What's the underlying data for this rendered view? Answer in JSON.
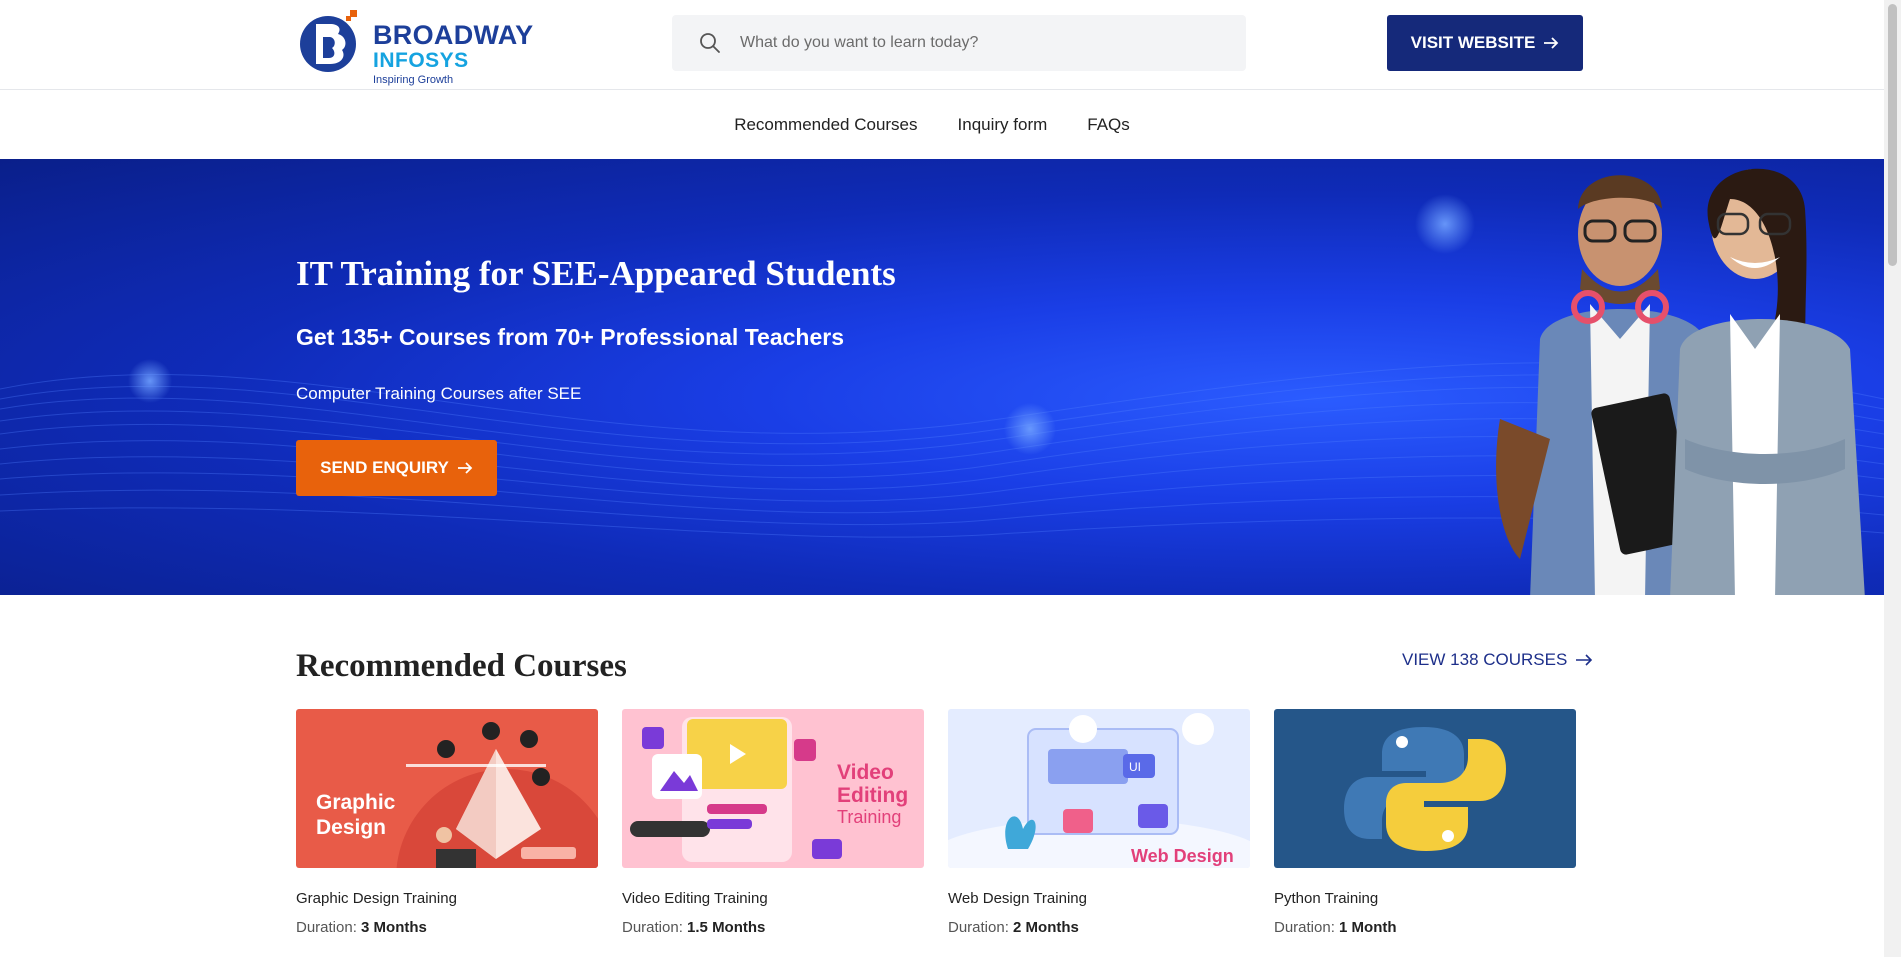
{
  "header": {
    "logo": {
      "brand_line1": "BROADWAY",
      "brand_line2": "INFOSYS",
      "tagline": "Inspiring Growth"
    },
    "search": {
      "placeholder": "What do you want to learn today?",
      "icon": "search-icon"
    },
    "visit_button": {
      "label": "VISIT WEBSITE",
      "icon": "arrow-right-icon"
    }
  },
  "nav": {
    "items": [
      {
        "label": "Recommended Courses"
      },
      {
        "label": "Inquiry form"
      },
      {
        "label": "FAQs"
      }
    ]
  },
  "hero": {
    "title": "IT Training for SEE-Appeared Students",
    "subtitle": "Get 135+ Courses from 70+ Professional Teachers",
    "description": "Computer Training Courses after SEE",
    "cta": {
      "label": "SEND ENQUIRY",
      "icon": "arrow-right-icon"
    }
  },
  "courses": {
    "heading": "Recommended Courses",
    "view_all": {
      "label": "VIEW 138 COURSES",
      "icon": "arrow-right-icon"
    },
    "duration_label": "Duration:",
    "items": [
      {
        "name": "Graphic Design Training",
        "duration": "3 Months",
        "thumb_text": [
          "Graphic",
          "Design"
        ],
        "thumb_color": "#e85b48"
      },
      {
        "name": "Video Editing Training",
        "duration": "1.5 Months",
        "thumb_text": [
          "Video",
          "Editing",
          "Training"
        ],
        "thumb_color": "#ffc2d1"
      },
      {
        "name": "Web Design Training",
        "duration": "2 Months",
        "thumb_text": [
          "UI",
          "Web Design"
        ],
        "thumb_color": "#e4ecff"
      },
      {
        "name": "Python Training",
        "duration": "1 Month",
        "thumb_text": [],
        "thumb_color": "#255689"
      }
    ]
  },
  "colors": {
    "brand_blue": "#15297a",
    "cta_orange": "#e8620c",
    "hero_blue": "#1a3ee6"
  }
}
